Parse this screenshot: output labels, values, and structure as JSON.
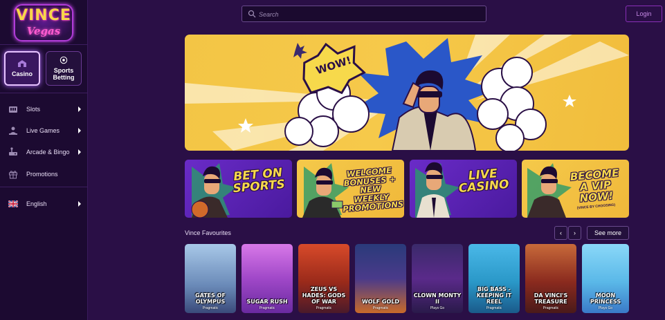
{
  "brand": {
    "logo_top": "VINCE",
    "logo_bottom": "Vegas"
  },
  "categories": [
    {
      "label": "Casino",
      "icon": "casino-icon"
    },
    {
      "label": "Sports Betting",
      "icon": "soccer-ball-icon"
    }
  ],
  "nav": [
    {
      "label": "Slots",
      "icon": "slots-icon",
      "has_submenu": true
    },
    {
      "label": "Live Games",
      "icon": "live-dealer-icon",
      "has_submenu": true
    },
    {
      "label": "Arcade & Bingo",
      "icon": "arcade-icon",
      "has_submenu": true
    },
    {
      "label": "Promotions",
      "icon": "gift-icon",
      "has_submenu": false
    }
  ],
  "language": {
    "label": "English",
    "icon": "uk-flag-icon"
  },
  "header": {
    "search_placeholder": "Search",
    "login_label": "Login"
  },
  "hero": {
    "speech_bubble": "WOW!"
  },
  "promos": [
    {
      "title": "BET ON SPORTS",
      "subtitle": ""
    },
    {
      "title": "WELCOME BONUSES + NEW WEEKLY PROMOTIONS",
      "subtitle": ""
    },
    {
      "title": "LIVE CASINO",
      "subtitle": ""
    },
    {
      "title": "BECOME A VIP NOW!",
      "subtitle": "(VINCE BY CHOOSING)"
    }
  ],
  "favourites": {
    "title": "Vince Favourites",
    "prev_label": "‹",
    "next_label": "›",
    "see_more_label": "See more",
    "games": [
      {
        "name": "GATES OF OLYMPUS",
        "provider": "Pragmatic",
        "color": "#7fa3c7"
      },
      {
        "name": "SUGAR RUSH",
        "provider": "Pragmatic",
        "color": "#c45ad8"
      },
      {
        "name": "ZEUS VS HADES: GODS OF WAR",
        "provider": "Pragmatic",
        "color": "#b4321f"
      },
      {
        "name": "WOLF GOLD",
        "provider": "Pragmatic",
        "color": "#3a2a6e"
      },
      {
        "name": "CLOWN MONTY II",
        "provider": "Plays Go",
        "color": "#4a2a7a"
      },
      {
        "name": "BIG BASS - KEEPING IT REEL",
        "provider": "Pragmatic",
        "color": "#2aa0c8"
      },
      {
        "name": "DA VINCI'S TREASURE",
        "provider": "Pragmatic",
        "color": "#8a2a1e"
      },
      {
        "name": "MOON PRINCESS",
        "provider": "Plays Go",
        "color": "#5bb8e8"
      }
    ]
  },
  "colors": {
    "background": "#2a0f46",
    "sidebar": "#1c0a31",
    "accent": "#8a2fb8",
    "brand_yellow": "#f3c545"
  }
}
